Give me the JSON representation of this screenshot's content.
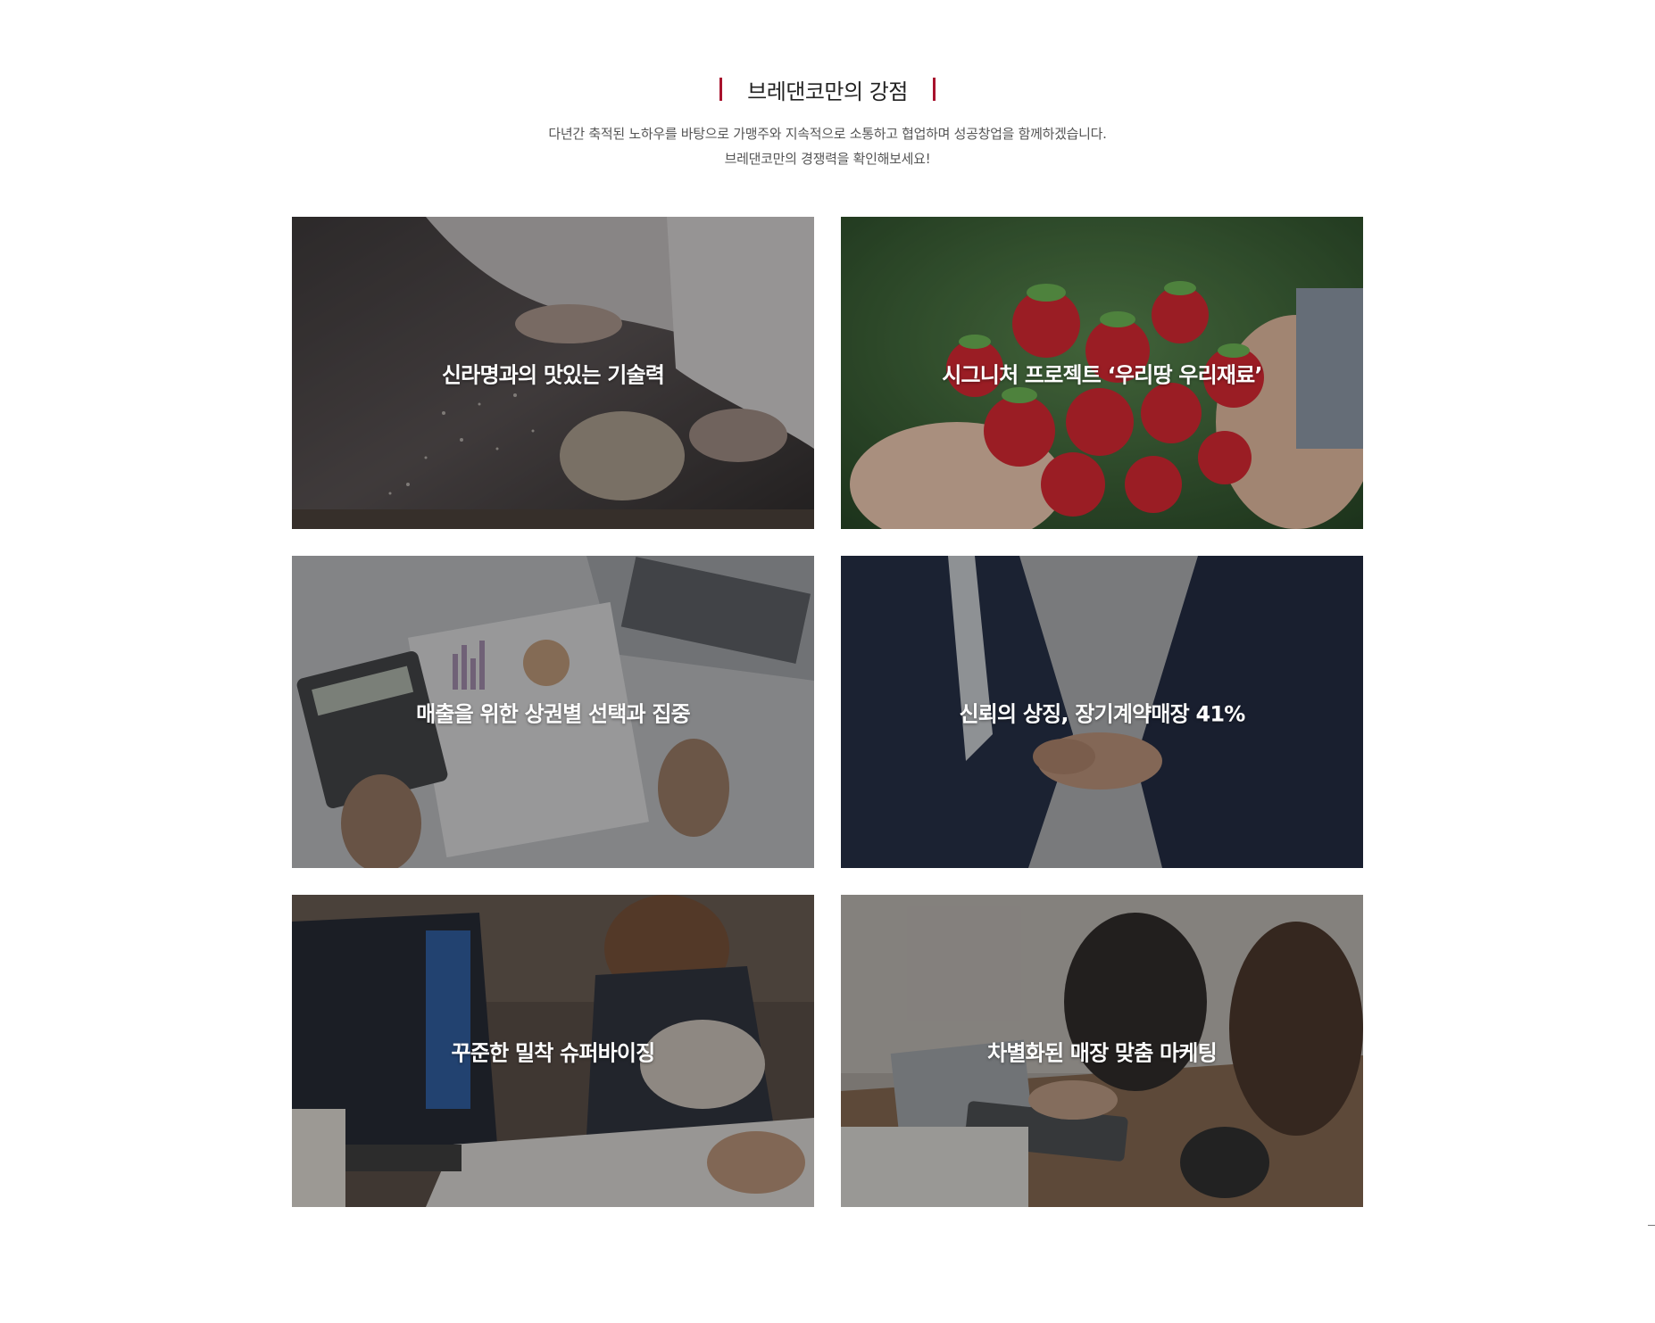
{
  "section": {
    "title": "브레댄코만의 강점",
    "subtitle_line1": "다년간 축적된 노하우를 바탕으로 가맹주와 지속적으로 소통하고 협업하며 성공창업을 함께하겠습니다.",
    "subtitle_line2": "브레댄코만의 경쟁력을 확인해보세요!",
    "accent_color": "#a8122d"
  },
  "cards": [
    {
      "caption": "신라명과의 맛있는 기술력",
      "image": "baker-dusting-flour-on-dough"
    },
    {
      "caption": "시그니처 프로젝트 ‘우리땅 우리재료’",
      "image": "hands-holding-strawberries"
    },
    {
      "caption": "매출을 위한 상권별 선택과 집중",
      "image": "desk-with-calculator-and-charts"
    },
    {
      "caption": "신뢰의 상징, 장기계약매장 41%",
      "image": "business-handshake"
    },
    {
      "caption": "꾸준한 밀착 슈퍼바이징",
      "image": "team-meeting-with-documents"
    },
    {
      "caption": "차별화된 매장 맞춤 마케팅",
      "image": "women-working-with-tablet-and-laptop"
    }
  ]
}
